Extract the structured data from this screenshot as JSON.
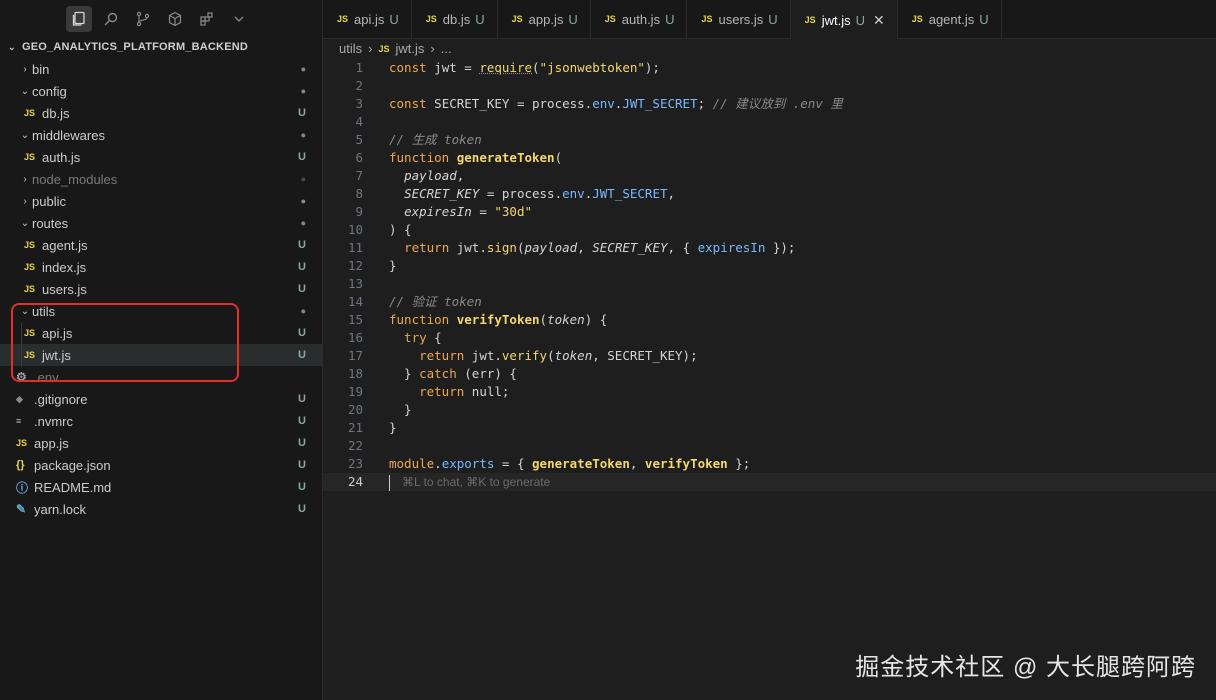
{
  "explorer": {
    "project_name": "GEO_ANALYTICS_PLATFORM_BACKEND",
    "items": [
      {
        "label": "bin",
        "status": "●"
      },
      {
        "label": "config",
        "status": "●"
      },
      {
        "label": "db.js",
        "status": "U"
      },
      {
        "label": "middlewares",
        "status": "●"
      },
      {
        "label": "auth.js",
        "status": "U"
      },
      {
        "label": "node_modules",
        "status": "●"
      },
      {
        "label": "public",
        "status": "●"
      },
      {
        "label": "routes",
        "status": "●"
      },
      {
        "label": "agent.js",
        "status": "U"
      },
      {
        "label": "index.js",
        "status": "U"
      },
      {
        "label": "users.js",
        "status": "U"
      },
      {
        "label": "utils",
        "status": "●"
      },
      {
        "label": "api.js",
        "status": "U"
      },
      {
        "label": "jwt.js",
        "status": "U"
      },
      {
        "label": ".env",
        "status": ""
      },
      {
        "label": ".gitignore",
        "status": "U"
      },
      {
        "label": ".nvmrc",
        "status": "U"
      },
      {
        "label": "app.js",
        "status": "U"
      },
      {
        "label": "package.json",
        "status": "U"
      },
      {
        "label": "README.md",
        "status": "U"
      },
      {
        "label": "yarn.lock",
        "status": "U"
      }
    ]
  },
  "tabs": [
    {
      "icon": "JS",
      "label": "api.js",
      "status": "U"
    },
    {
      "icon": "JS",
      "label": "db.js",
      "status": "U"
    },
    {
      "icon": "JS",
      "label": "app.js",
      "status": "U"
    },
    {
      "icon": "JS",
      "label": "auth.js",
      "status": "U"
    },
    {
      "icon": "JS",
      "label": "users.js",
      "status": "U"
    },
    {
      "icon": "JS",
      "label": "jwt.js",
      "status": "U",
      "close": "✕"
    },
    {
      "icon": "JS",
      "label": "agent.js",
      "status": "U"
    }
  ],
  "breadcrumb": {
    "folder": "utils",
    "icon": "JS",
    "file": "jwt.js",
    "more": "..."
  },
  "editor": {
    "line_numbers": [
      "1",
      "2",
      "3",
      "4",
      "5",
      "6",
      "7",
      "8",
      "9",
      "10",
      "11",
      "12",
      "13",
      "14",
      "15",
      "16",
      "17",
      "18",
      "19",
      "20",
      "21",
      "22",
      "23",
      "24"
    ],
    "current_line_hint": "⌘L to chat, ⌘K to generate"
  },
  "colors": {
    "accent_highlight": "#e0302a",
    "untracked": "#8ca89a",
    "js_icon": "#e8d44d"
  },
  "watermark": "掘金技术社区 @ 大长腿跨阿跨"
}
